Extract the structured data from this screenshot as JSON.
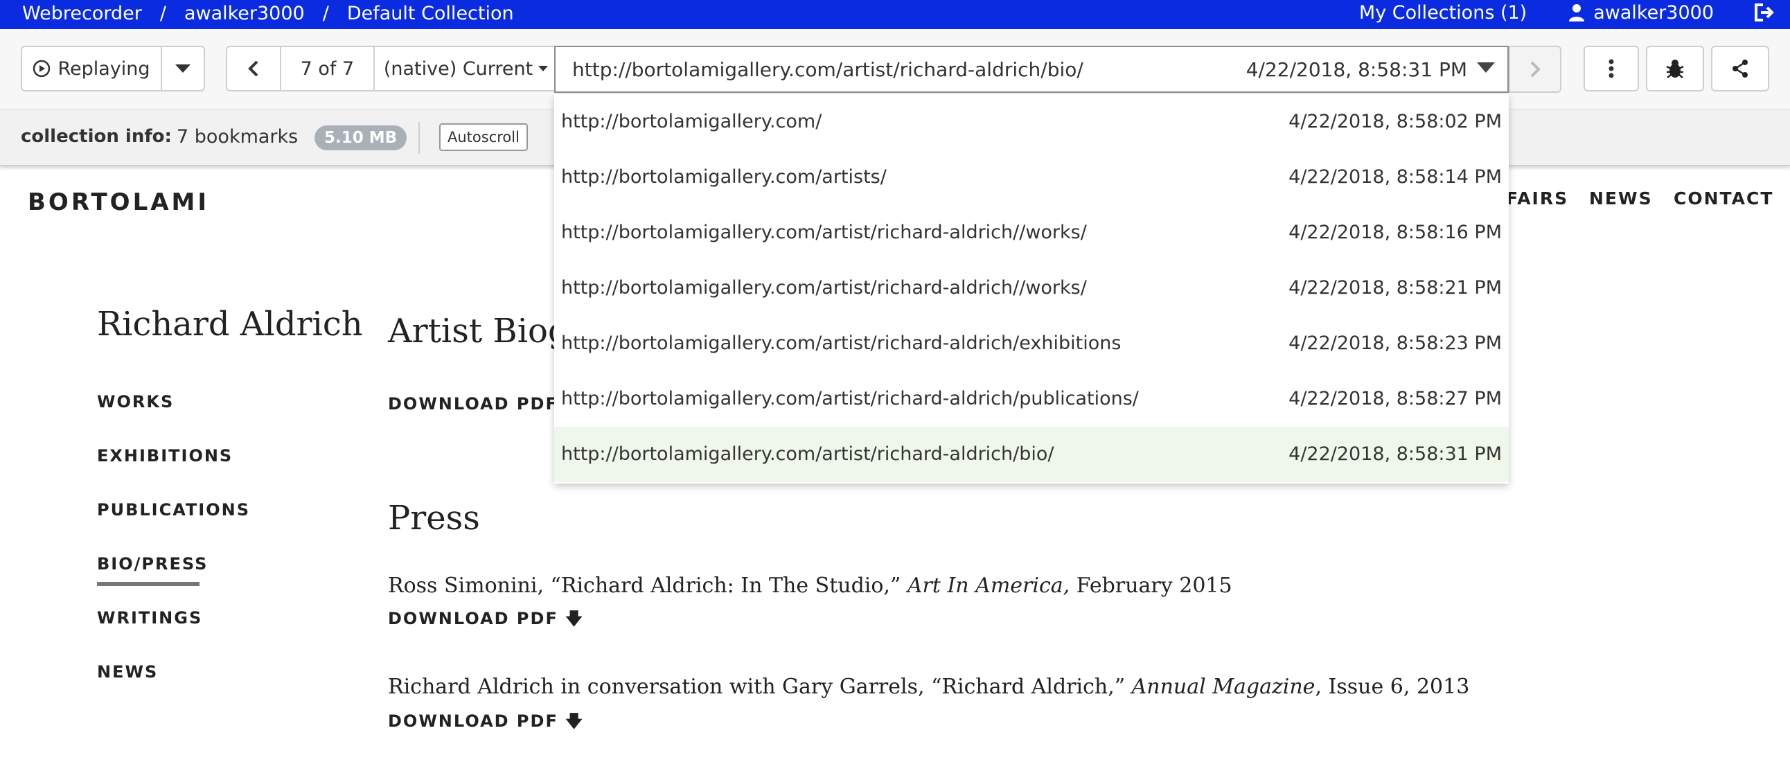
{
  "topbar": {
    "app_name": "Webrecorder",
    "separator": "/",
    "user_crumb": "awalker3000",
    "collection_crumb": "Default Collection",
    "my_collections": "My Collections (1)",
    "username": "awalker3000",
    "icons": {
      "user": "user-icon",
      "logout": "logout-icon"
    },
    "color": "#0a2bdf"
  },
  "toolbar": {
    "mode_label": "Replaying",
    "page_counter": "7 of 7",
    "browser_label": "(native) Current",
    "url": "http://bortolamigallery.com/artist/richard-aldrich/bio/",
    "timestamp": "4/22/2018, 8:58:31 PM",
    "icons": {
      "mode": "play-circle-icon",
      "mode_menu": "caret-down-icon",
      "back": "chevron-left-icon",
      "forward": "chevron-right-icon",
      "more": "vertical-ellipsis-icon",
      "bug": "bug-icon",
      "share": "share-icon"
    }
  },
  "collection_info": {
    "label": "collection info:",
    "bookmarks": "7 bookmarks",
    "size": "5.10 MB",
    "autoscroll": "Autoscroll"
  },
  "dropdown": {
    "items": [
      {
        "url": "http://bortolamigallery.com/",
        "time": "4/22/2018, 8:58:02 PM"
      },
      {
        "url": "http://bortolamigallery.com/artists/",
        "time": "4/22/2018, 8:58:14 PM"
      },
      {
        "url": "http://bortolamigallery.com/artist/richard-aldrich//works/",
        "time": "4/22/2018, 8:58:16 PM"
      },
      {
        "url": "http://bortolamigallery.com/artist/richard-aldrich//works/",
        "time": "4/22/2018, 8:58:21 PM"
      },
      {
        "url": "http://bortolamigallery.com/artist/richard-aldrich/exhibitions",
        "time": "4/22/2018, 8:58:23 PM"
      },
      {
        "url": "http://bortolamigallery.com/artist/richard-aldrich/publications/",
        "time": "4/22/2018, 8:58:27 PM"
      },
      {
        "url": "http://bortolamigallery.com/artist/richard-aldrich/bio/",
        "time": "4/22/2018, 8:58:31 PM"
      }
    ],
    "active_index": 6,
    "active_color": "#eef7ea"
  },
  "site": {
    "logo": "BORTOLAMI",
    "nav": [
      "FAIRS",
      "NEWS",
      "CONTACT"
    ],
    "artist": "Richard Aldrich",
    "sidenav": [
      "WORKS",
      "EXHIBITIONS",
      "PUBLICATIONS",
      "BIO/PRESS",
      "WRITINGS",
      "NEWS"
    ],
    "sidenav_active": "BIO/PRESS",
    "bio_heading": "Artist Biog",
    "download_pdf": "DOWNLOAD PDF",
    "download_icon": "arrow-down-icon",
    "press_heading": "Press",
    "press": [
      {
        "pre": "Ross Simonini, “Richard Aldrich: In The Studio,”",
        "italic": "Art In America,",
        "post": "February 2015"
      },
      {
        "pre": "Richard Aldrich in conversation with Gary Garrels, “Richard Aldrich,”",
        "italic": "Annual Magazine",
        "post": ", Issue 6, 2013"
      }
    ]
  }
}
